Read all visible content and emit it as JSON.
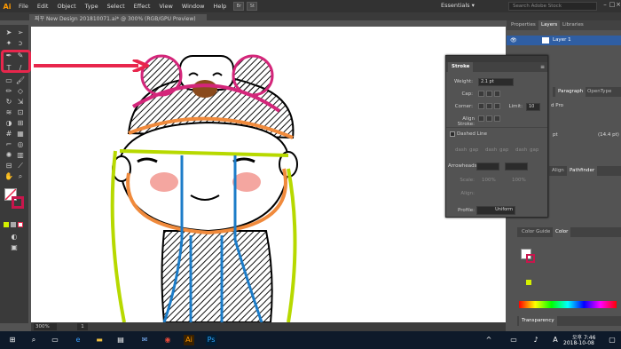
{
  "app": {
    "logo": "Ai"
  },
  "menu": [
    "File",
    "Edit",
    "Object",
    "Type",
    "Select",
    "Effect",
    "View",
    "Window",
    "Help"
  ],
  "bridge_buttons": [
    "Br",
    "St"
  ],
  "workspace": "Essentials ▾",
  "search_placeholder": "Search Adobe Stock",
  "document_tab": "찌꾸 New Design 20181007​1.ai* @ 300% (RGB/GPU Preview)",
  "doc_tab_close": "×",
  "status": {
    "zoom": "300%",
    "page": "1"
  },
  "panels": {
    "top_tabs": [
      "Properties",
      "Layers",
      "Libraries"
    ],
    "layer_name": "Layer 1",
    "mid_tabs": [
      "Paragraph",
      "OpenType"
    ],
    "pro_text": "d Pro",
    "pt_field1": "pt",
    "pt_field2": "(14.4 pt)",
    "align_tabs": [
      "Align",
      "Pathfinder"
    ],
    "color_tabs": [
      "Color Guide",
      "Color"
    ],
    "transparency": "Transparency"
  },
  "stroke_panel": {
    "title": "Stroke",
    "weight_label": "Weight:",
    "weight_value": "2.1 pt",
    "cap_label": "Cap:",
    "corner_label": "Corner:",
    "limit_label": "Limit:",
    "limit_value": "10",
    "align_label": "Align Stroke:",
    "dashed_label": "Dashed Line",
    "dash_labels": [
      "dash",
      "gap",
      "dash",
      "gap",
      "dash",
      "gap"
    ],
    "arrowheads_label": "Arrowheads:",
    "scale_label": "Scale:",
    "scale_values": [
      "100%",
      "100%"
    ],
    "align_arrow_label": "Align:",
    "profile_label": "Profile:",
    "profile_value": "Uniform"
  },
  "taskbar": {
    "time": "오후 7:46",
    "date": "2018-10-08"
  },
  "colors": {
    "accent_red": "#e8264c",
    "canvas": "#ffffff",
    "ui_dark": "#535353",
    "layer_blue": "#2f5ea3",
    "ai_orange": "#ff9a00"
  }
}
